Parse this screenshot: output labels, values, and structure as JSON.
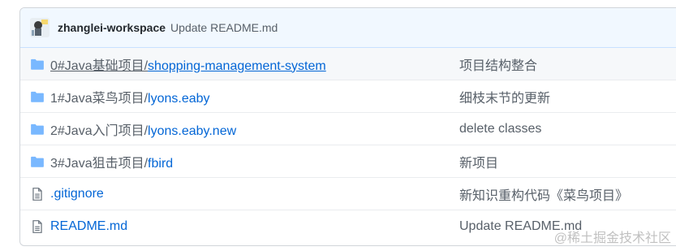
{
  "commit": {
    "author": "zhanglei-workspace",
    "message": "Update README.md"
  },
  "rows": [
    {
      "type": "folder",
      "icon": "folder-icon",
      "prefix": "0#Java基础项目/",
      "link": "shopping-management-system",
      "message": "项目结构整合"
    },
    {
      "type": "folder",
      "icon": "folder-icon",
      "prefix": "1#Java菜鸟项目/",
      "link": "lyons.eaby",
      "message": "细枝末节的更新"
    },
    {
      "type": "folder",
      "icon": "folder-icon",
      "prefix": "2#Java入门项目/",
      "link": "lyons.eaby.new",
      "message": "delete classes"
    },
    {
      "type": "folder",
      "icon": "folder-icon",
      "prefix": "3#Java狙击项目/",
      "link": "fbird",
      "message": "新项目"
    },
    {
      "type": "file",
      "icon": "file-icon",
      "prefix": "",
      "link": ".gitignore",
      "message": "新知识重构代码《菜鸟项目》"
    },
    {
      "type": "file",
      "icon": "file-icon",
      "prefix": "",
      "link": "README.md",
      "message": "Update README.md"
    }
  ],
  "watermark": "@稀土掘金技术社区",
  "colors": {
    "link": "#0366d6",
    "folder": "#79b8ff",
    "commit_bar": "#f1f8ff"
  }
}
